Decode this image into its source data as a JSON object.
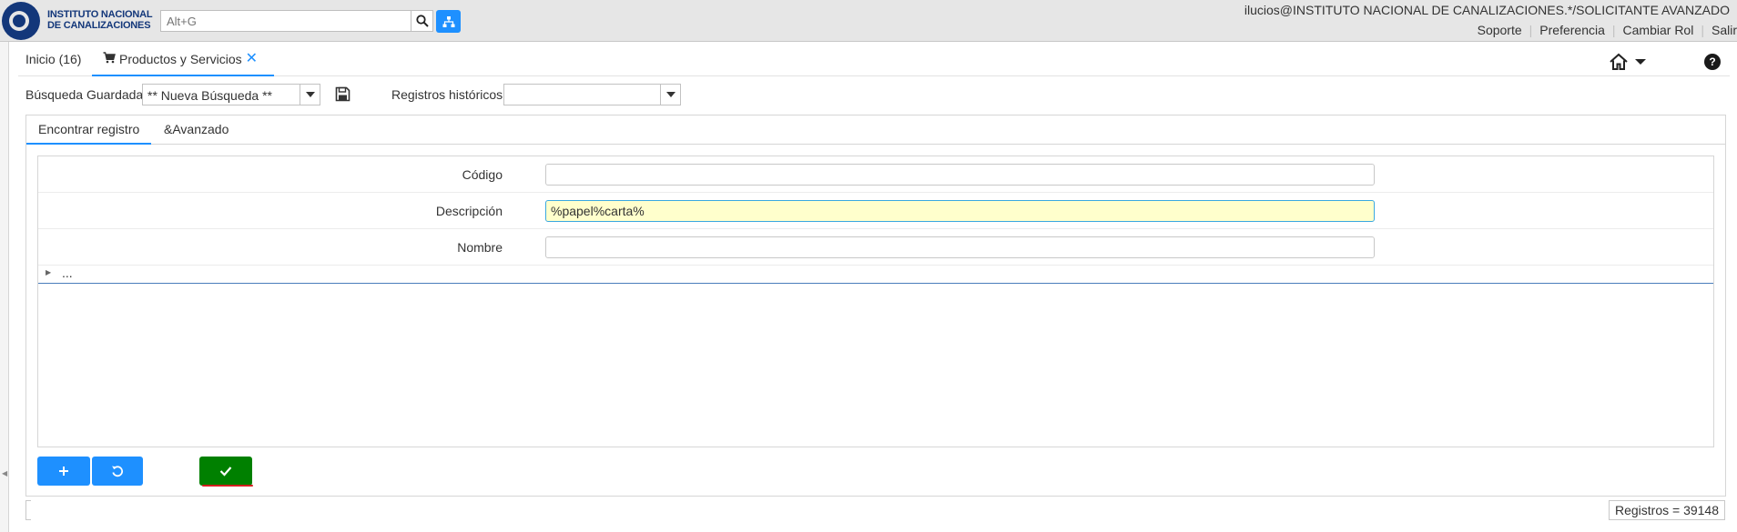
{
  "header": {
    "logo": {
      "line1": "INSTITUTO NACIONAL",
      "line2": "DE CANALIZACIONES"
    },
    "search": {
      "placeholder": "Alt+G"
    },
    "icons": {
      "search": "search-icon",
      "tree": "sitemap-icon"
    },
    "user": "ilucios@INSTITUTO NACIONAL DE CANALIZACIONES.*/SOLICITANTE AVANZADO",
    "links": [
      "Soporte",
      "Preferencia",
      "Cambiar Rol",
      "Salir"
    ]
  },
  "tabs": {
    "home": "Inicio (16)",
    "products": "Productos y Servicios"
  },
  "query": {
    "saved_label": "Búsqueda Guardada",
    "saved_value": "** Nueva Búsqueda **",
    "history_label": "Registros históricos",
    "history_value": ""
  },
  "panel": {
    "tab_find": "Encontrar registro",
    "tab_advanced": "&Avanzado",
    "fields": [
      {
        "label": "Código",
        "value": ""
      },
      {
        "label": "Descripción",
        "value": "%papel%carta%"
      },
      {
        "label": "Nombre",
        "value": ""
      }
    ],
    "more": "..."
  },
  "status": {
    "count": "Registros = 39148"
  },
  "colors": {
    "accent": "#1e90ff",
    "ok": "#008000",
    "brand": "#13377a",
    "active_field": "#ffffcc"
  }
}
